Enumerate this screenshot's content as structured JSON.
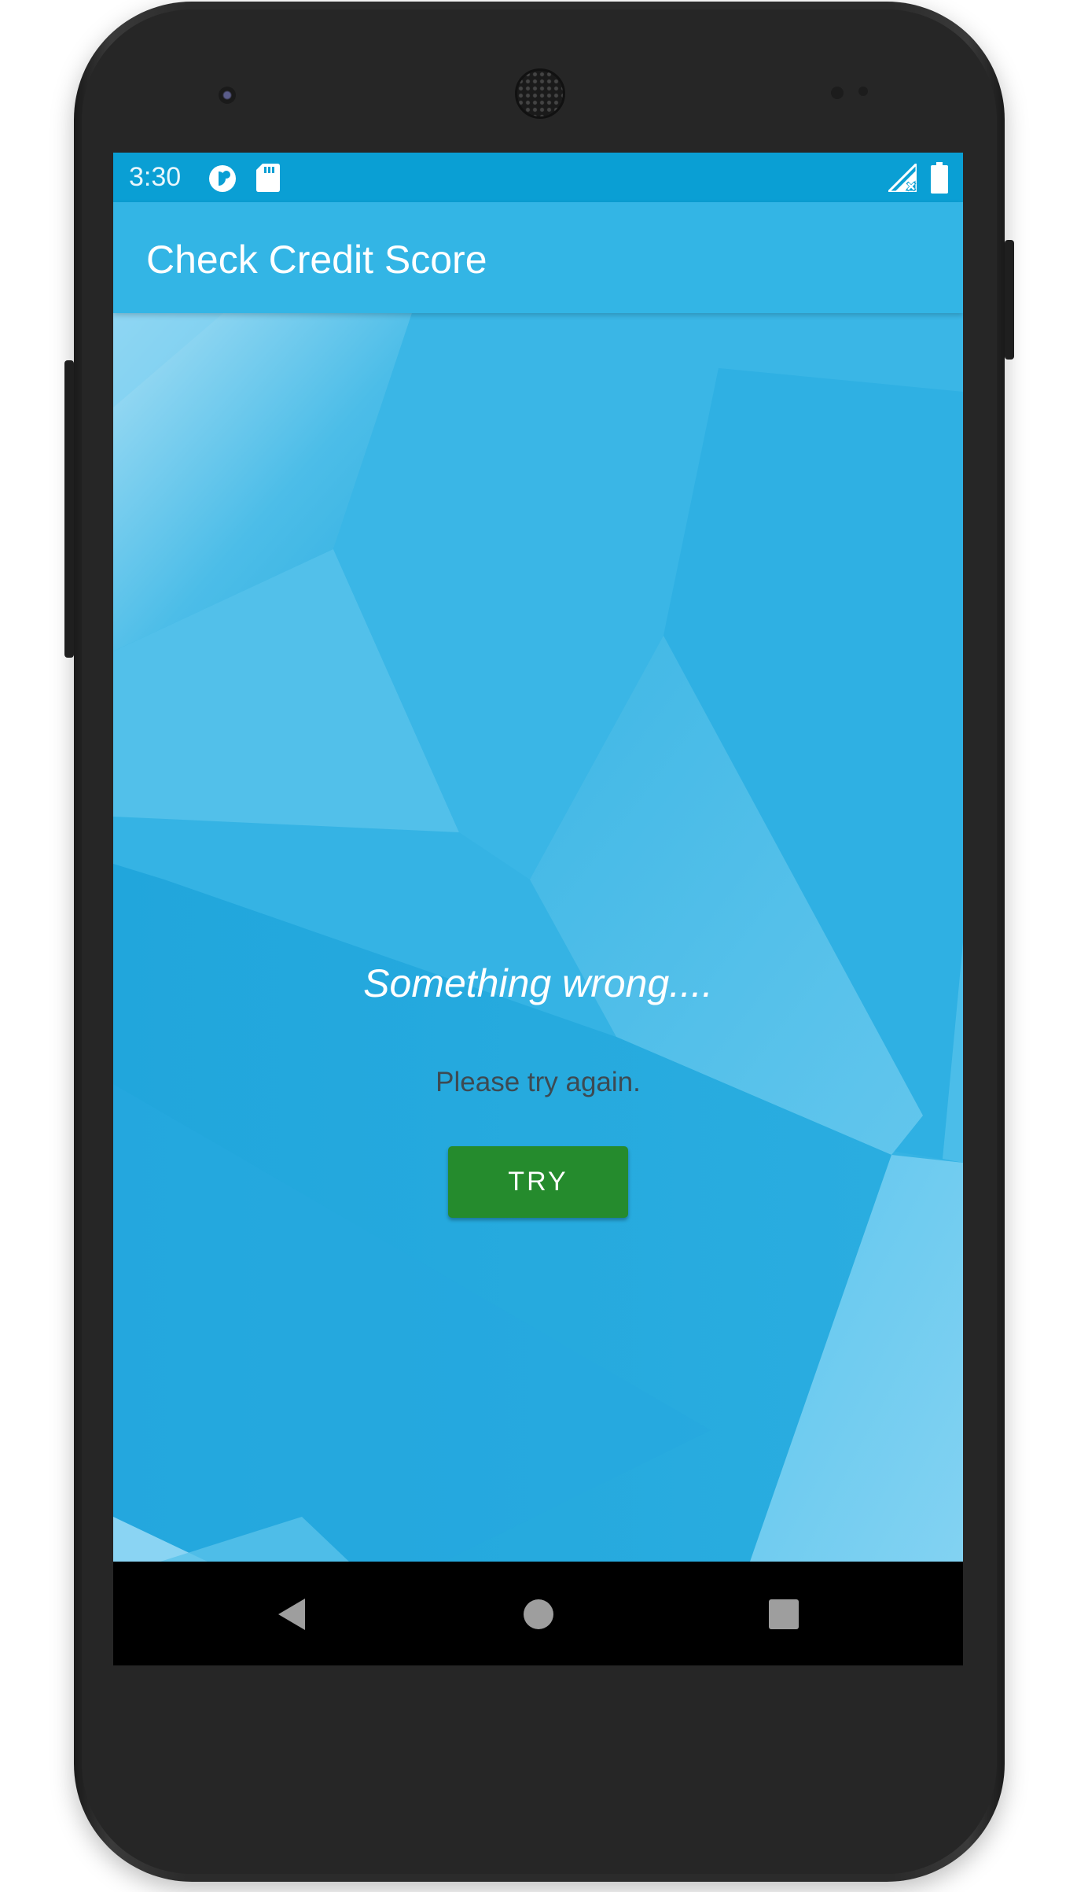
{
  "status_bar": {
    "time": "3:30",
    "icons": [
      "app-notification-icon",
      "sd-card-icon",
      "no-signal-icon",
      "battery-icon"
    ]
  },
  "app_bar": {
    "title": "Check Credit Score"
  },
  "error": {
    "title": "Something wrong....",
    "message": "Please try again.",
    "retry_button": "TRY"
  },
  "nav_bar": {
    "buttons": [
      "back-icon",
      "home-icon",
      "recents-icon"
    ]
  },
  "colors": {
    "status_bar": "#0a9fd4",
    "app_bar": "#33b5e5",
    "background": "#2eaee0",
    "retry_button": "#258b2d"
  }
}
